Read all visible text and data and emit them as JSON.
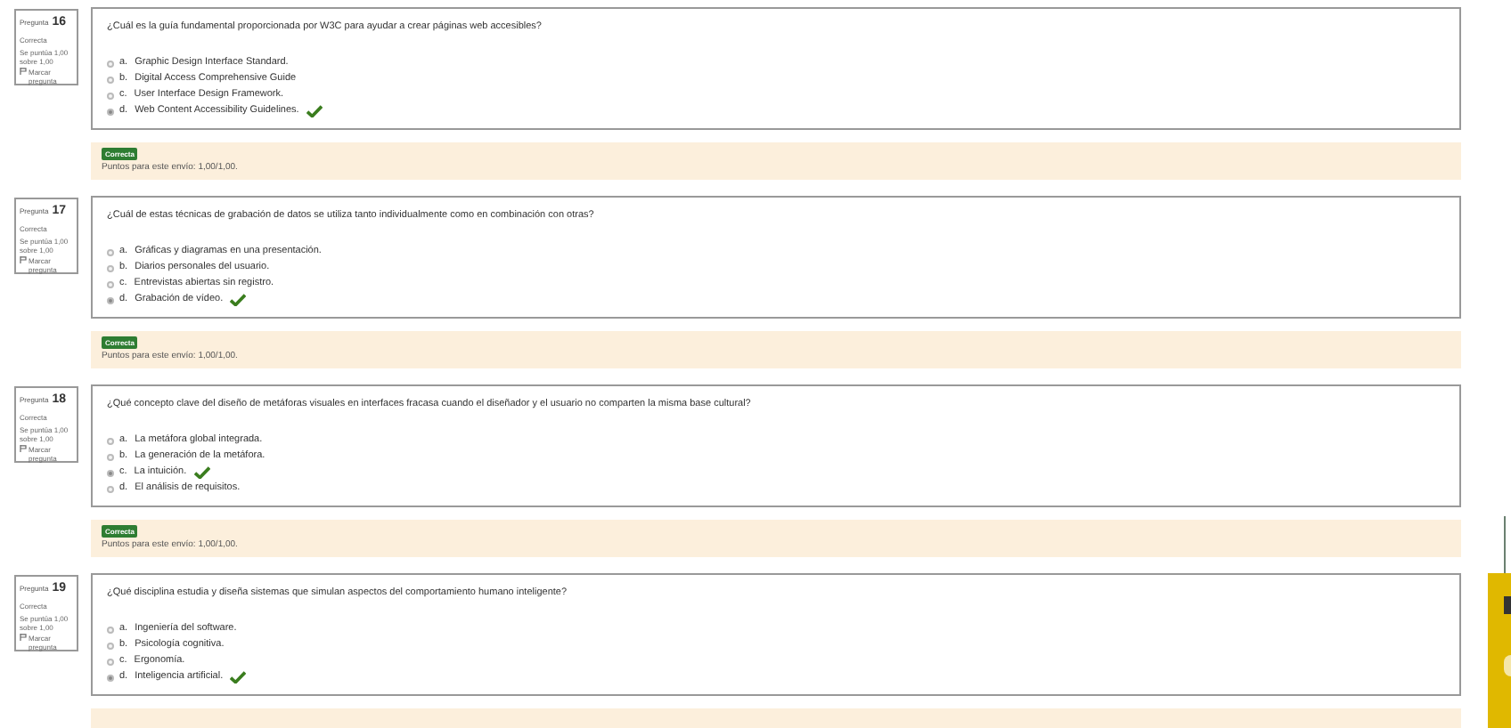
{
  "questions": [
    {
      "label": "Pregunta",
      "number": "16",
      "status": "Correcta",
      "score": "Se puntúa 1,00 sobre 1,00",
      "flag": "Marcar pregunta",
      "text": "¿Cuál es la guía fundamental proporcionada por W3C para ayudar a crear páginas web accesibles?",
      "options": [
        {
          "letter": "a.",
          "text": "Graphic Design Interface Standard.",
          "selected": false,
          "correct": false
        },
        {
          "letter": "b.",
          "text": "Digital Access Comprehensive Guide",
          "selected": false,
          "correct": false
        },
        {
          "letter": "c.",
          "text": "User Interface Design Framework.",
          "selected": false,
          "correct": false
        },
        {
          "letter": "d.",
          "text": "Web Content Accessibility Guidelines.",
          "selected": true,
          "correct": true
        }
      ],
      "feedback": {
        "badge": "Correcta",
        "text": "Puntos para este envío: 1,00/1,00."
      }
    },
    {
      "label": "Pregunta",
      "number": "17",
      "status": "Correcta",
      "score": "Se puntúa 1,00 sobre 1,00",
      "flag": "Marcar pregunta",
      "text": "¿Cuál de estas técnicas de grabación de datos se utiliza tanto individualmente como en combinación con otras?",
      "options": [
        {
          "letter": "a.",
          "text": "Gráficas y diagramas en una presentación.",
          "selected": false,
          "correct": false
        },
        {
          "letter": "b.",
          "text": "Diarios personales del usuario.",
          "selected": false,
          "correct": false
        },
        {
          "letter": "c.",
          "text": "Entrevistas abiertas sin registro.",
          "selected": false,
          "correct": false
        },
        {
          "letter": "d.",
          "text": "Grabación de vídeo.",
          "selected": true,
          "correct": true
        }
      ],
      "feedback": {
        "badge": "Correcta",
        "text": "Puntos para este envío: 1,00/1,00."
      }
    },
    {
      "label": "Pregunta",
      "number": "18",
      "status": "Correcta",
      "score": "Se puntúa 1,00 sobre 1,00",
      "flag": "Marcar pregunta",
      "text": "¿Qué concepto clave del diseño de metáforas visuales en interfaces fracasa cuando el diseñador y el usuario no comparten la misma base cultural?",
      "options": [
        {
          "letter": "a.",
          "text": "La metáfora global integrada.",
          "selected": false,
          "correct": false
        },
        {
          "letter": "b.",
          "text": "La generación de la metáfora.",
          "selected": false,
          "correct": false
        },
        {
          "letter": "c.",
          "text": "La intuición.",
          "selected": true,
          "correct": true
        },
        {
          "letter": "d.",
          "text": "El análisis de requisitos.",
          "selected": false,
          "correct": false
        }
      ],
      "feedback": {
        "badge": "Correcta",
        "text": "Puntos para este envío: 1,00/1,00."
      }
    },
    {
      "label": "Pregunta",
      "number": "19",
      "status": "Correcta",
      "score": "Se puntúa 1,00 sobre 1,00",
      "flag": "Marcar pregunta",
      "text": "¿Qué disciplina estudia y diseña sistemas que simulan aspectos del comportamiento humano inteligente?",
      "options": [
        {
          "letter": "a.",
          "text": "Ingeniería del software.",
          "selected": false,
          "correct": false
        },
        {
          "letter": "b.",
          "text": "Psicología cognitiva.",
          "selected": false,
          "correct": false
        },
        {
          "letter": "c.",
          "text": "Ergonomía.",
          "selected": false,
          "correct": false
        },
        {
          "letter": "d.",
          "text": "Inteligencia artificial.",
          "selected": true,
          "correct": true
        }
      ]
    }
  ]
}
